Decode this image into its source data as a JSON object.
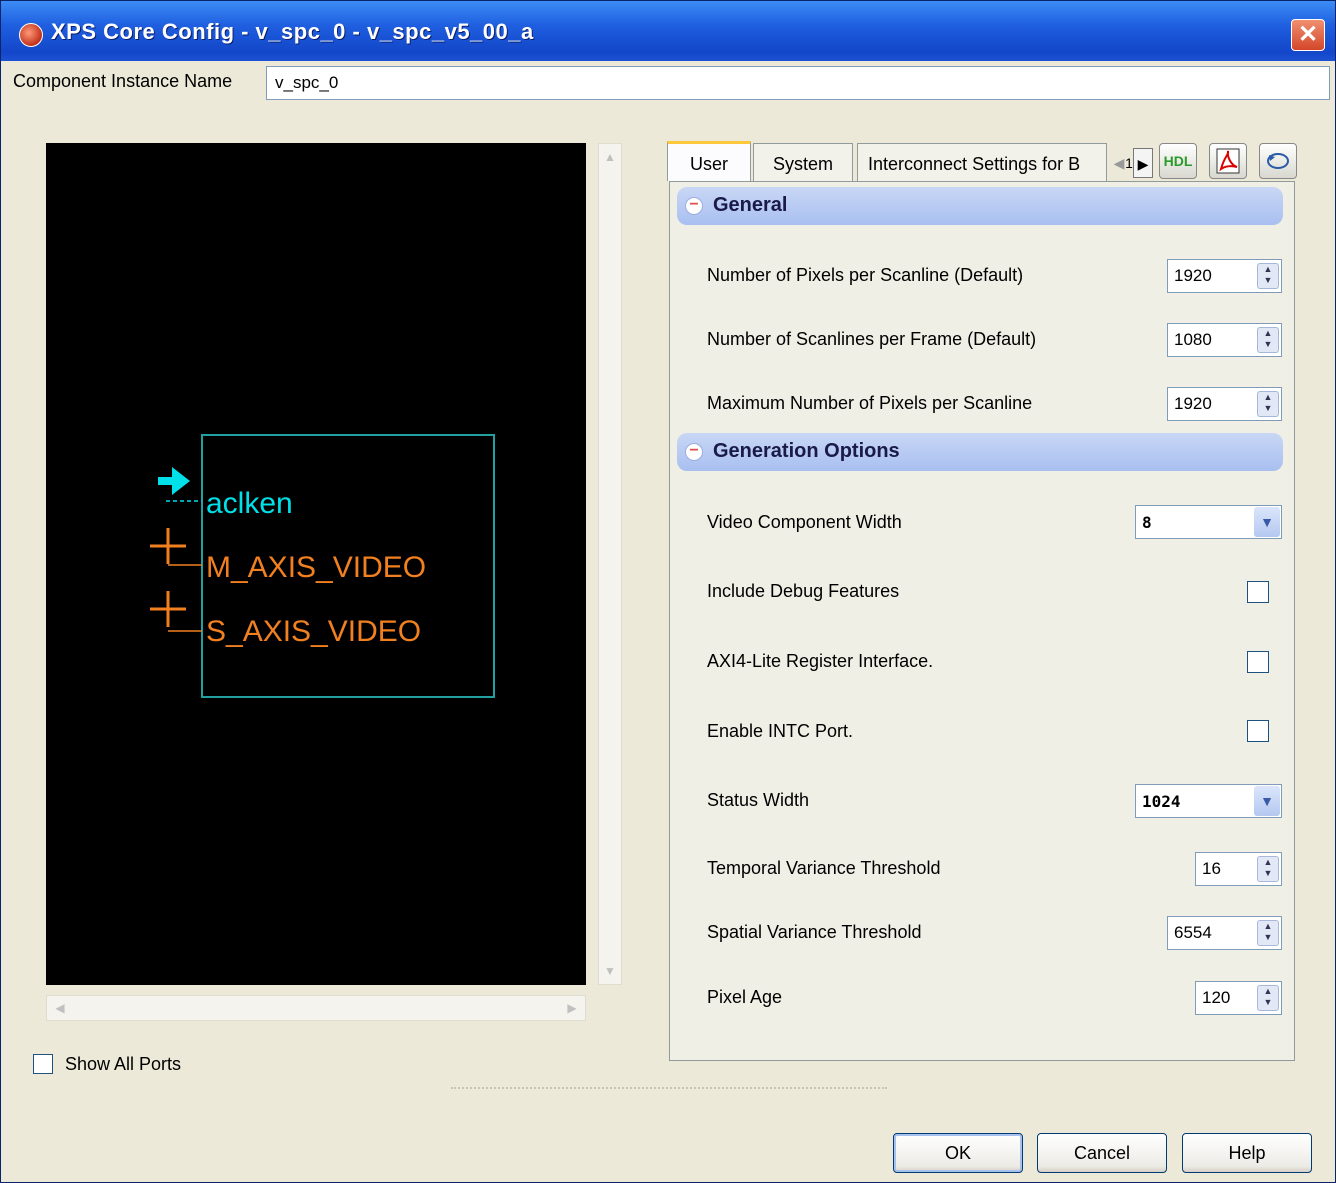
{
  "window": {
    "title": "XPS Core Config - v_spc_0 - v_spc_v5_00_a",
    "close_glyph": "✕"
  },
  "instance": {
    "label": "Component Instance Name",
    "value": "v_spc_0"
  },
  "symbol": {
    "ports": [
      "aclken",
      "M_AXIS_VIDEO",
      "S_AXIS_VIDEO"
    ],
    "colors": {
      "aclken": "#00e0e8",
      "bus": "#f08020",
      "box": "#20a0a0"
    }
  },
  "show_all_ports": {
    "label": "Show All Ports",
    "checked": false
  },
  "tabs": {
    "items": [
      "User",
      "System",
      "Interconnect Settings for B"
    ],
    "active": "User",
    "overflow_digit": "1",
    "hdl_label": "HDL"
  },
  "sections": {
    "general": "General",
    "generation": "Generation Options"
  },
  "params": {
    "pixels_per_scanline": {
      "label": "Number of Pixels per Scanline (Default)",
      "value": "1920"
    },
    "scanlines_per_frame": {
      "label": "Number of Scanlines per Frame (Default)",
      "value": "1080"
    },
    "max_pixels_per_scanline": {
      "label": "Maximum Number of Pixels per Scanline",
      "value": "1920"
    },
    "video_component_width": {
      "label": "Video Component Width",
      "value": "8"
    },
    "include_debug": {
      "label": "Include Debug Features",
      "checked": false
    },
    "axi4_lite": {
      "label": "AXI4-Lite Register Interface.",
      "checked": false
    },
    "enable_intc": {
      "label": "Enable INTC Port.",
      "checked": false
    },
    "status_width": {
      "label": "Status Width",
      "value": "1024"
    },
    "temporal_threshold": {
      "label": "Temporal Variance Threshold",
      "value": "16"
    },
    "spatial_threshold": {
      "label": "Spatial Variance Threshold",
      "value": "6554"
    },
    "pixel_age": {
      "label": "Pixel Age",
      "value": "120"
    }
  },
  "buttons": {
    "ok": "OK",
    "cancel": "Cancel",
    "help": "Help"
  }
}
